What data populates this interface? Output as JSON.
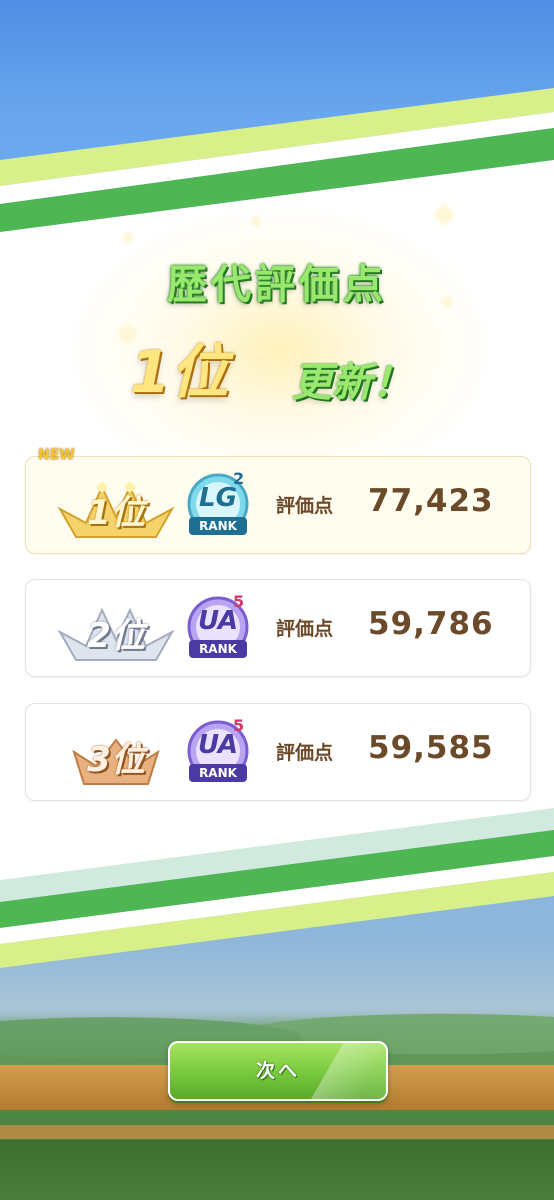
{
  "header": {
    "title": "歴代評価点",
    "rank": "1位",
    "updated": "更新！"
  },
  "rows": [
    {
      "is_new": true,
      "new_label": "NEW",
      "place": "1位",
      "rank_letters": "LG",
      "rank_level": "2",
      "rank_word": "RANK",
      "score_label": "評価点",
      "score": "77,423"
    },
    {
      "is_new": false,
      "place": "2位",
      "rank_letters": "UA",
      "rank_level": "5",
      "rank_word": "RANK",
      "score_label": "評価点",
      "score": "59,786"
    },
    {
      "is_new": false,
      "place": "3位",
      "rank_letters": "UA",
      "rank_level": "5",
      "rank_word": "RANK",
      "score_label": "評価点",
      "score": "59,585"
    }
  ],
  "footer": {
    "next_label": "次へ"
  },
  "colors": {
    "accent_green": "#77c83d",
    "score_brown": "#6b4a2a",
    "gold": "#f0c548",
    "silver": "#b9c2d4",
    "bronze": "#d69a64"
  }
}
